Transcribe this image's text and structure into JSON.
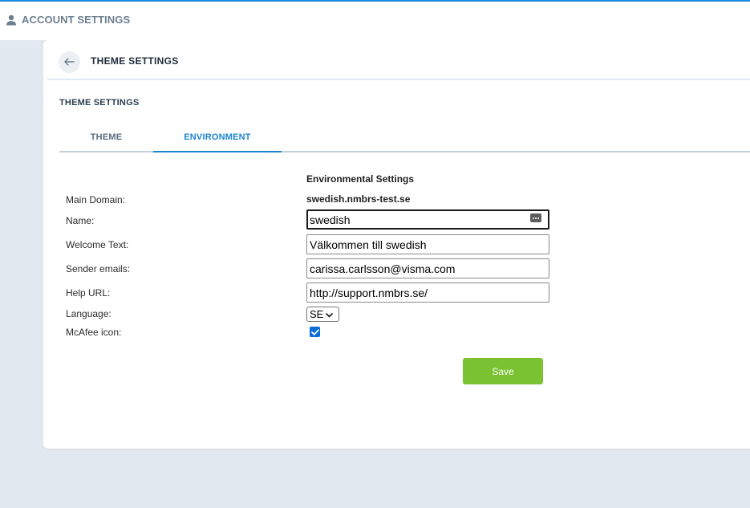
{
  "topbar": {
    "title": "ACCOUNT SETTINGS",
    "icon": "user-icon"
  },
  "header": {
    "back_icon": "arrow-left-icon",
    "title": "THEME SETTINGS"
  },
  "section": {
    "title": "THEME SETTINGS"
  },
  "tabs": [
    {
      "label": "THEME",
      "active": false
    },
    {
      "label": "ENVIRONMENT",
      "active": true
    }
  ],
  "form": {
    "heading": "Environmental Settings",
    "labels": {
      "main_domain": "Main Domain:",
      "name": "Name:",
      "welcome_text": "Welcome Text:",
      "sender_emails": "Sender emails:",
      "help_url": "Help URL:",
      "language": "Language:",
      "mcafee_icon": "McAfee icon:"
    },
    "main_domain": "swedish.nmbrs-test.se",
    "name": "swedish",
    "welcome_text": "Välkommen till swedish",
    "sender_emails": "carissa.carlsson@visma.com",
    "help_url": "http://support.nmbrs.se/",
    "language": "SE",
    "mcafee_icon_checked": true,
    "save_label": "Save"
  },
  "colors": {
    "accent": "#1a84d0",
    "save_button": "#7ac231",
    "background": "#e1e8f0"
  }
}
